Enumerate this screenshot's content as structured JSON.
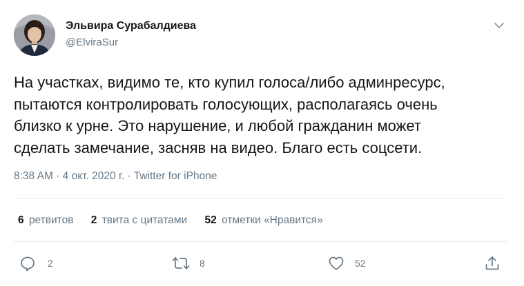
{
  "author": {
    "display_name": "Эльвира Сурабалдиева",
    "handle": "@ElviraSur"
  },
  "tweet": {
    "text": "На участках, видимо те, кто купил голоса/либо админресурс,\nпытаются контролировать голосующих, располагаясь очень\nблизко к урне. Это нарушение, и любой гражданин может\nсделать замечание, засняв на видео. Благо есть соцсети.",
    "time": "8:38 AM",
    "separator1": " · ",
    "date": "4 окт. 2020 г.",
    "separator2": " · ",
    "source": "Twitter for iPhone"
  },
  "stats": {
    "retweets_count": "6",
    "retweets_label": "ретвитов",
    "quotes_count": "2",
    "quotes_label": "твита с цитатами",
    "likes_count": "52",
    "likes_label": "отметки «Нравится»"
  },
  "actions": {
    "reply_count": "2",
    "retweet_count": "8",
    "like_count": "52"
  },
  "icons": {
    "caret": "chevron-down-icon",
    "reply": "reply-icon",
    "retweet": "retweet-icon",
    "like": "heart-icon",
    "share": "share-icon"
  },
  "colors": {
    "text": "#14171a",
    "secondary": "#657786",
    "divider": "#e6ecf0"
  }
}
